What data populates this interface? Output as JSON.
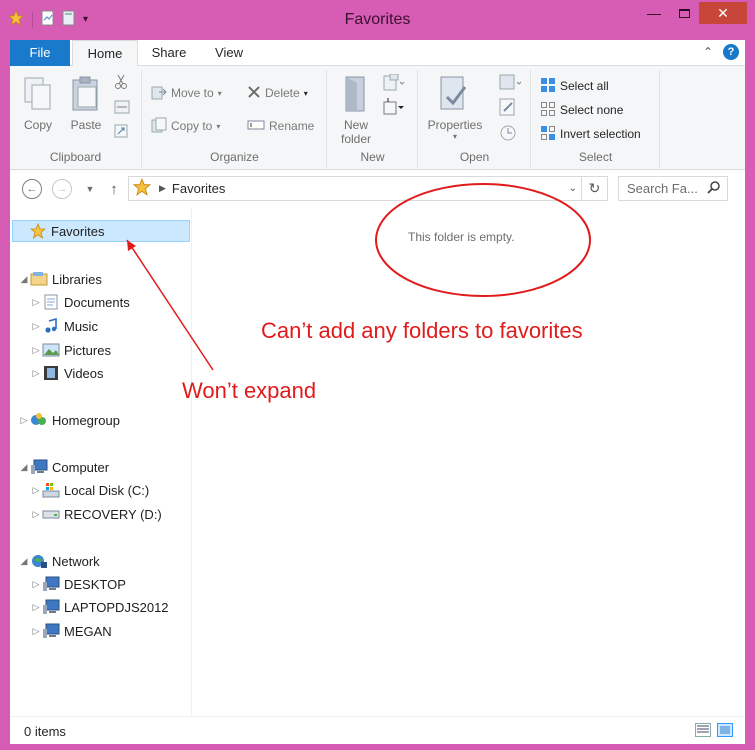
{
  "window": {
    "title": "Favorites"
  },
  "tabs": {
    "file": "File",
    "home": "Home",
    "share": "Share",
    "view": "View"
  },
  "ribbon": {
    "clipboard": {
      "label": "Clipboard",
      "copy": "Copy",
      "paste": "Paste"
    },
    "organize": {
      "label": "Organize",
      "move_to": "Move to",
      "copy_to": "Copy to",
      "delete": "Delete",
      "rename": "Rename"
    },
    "new": {
      "label": "New",
      "new_folder_line1": "New",
      "new_folder_line2": "folder"
    },
    "open": {
      "label": "Open",
      "properties": "Properties"
    },
    "select": {
      "label": "Select",
      "select_all": "Select all",
      "select_none": "Select none",
      "invert": "Invert selection"
    }
  },
  "address": {
    "crumb": "Favorites",
    "search_placeholder": "Search Fa..."
  },
  "nav": {
    "favorites": "Favorites",
    "libraries": "Libraries",
    "documents": "Documents",
    "music": "Music",
    "pictures": "Pictures",
    "videos": "Videos",
    "homegroup": "Homegroup",
    "computer": "Computer",
    "local_disk": "Local Disk (C:)",
    "recovery": "RECOVERY (D:)",
    "network": "Network",
    "desktop": "DESKTOP",
    "laptop": "LAPTOPDJS2012",
    "megan": "MEGAN"
  },
  "content": {
    "empty_message": "This folder is empty."
  },
  "annotations": {
    "cant_add": "Can’t add any folders to favorites",
    "wont_expand": "Won’t expand",
    "color": "#e11b1b"
  },
  "status": {
    "items": "0 items"
  },
  "colors": {
    "frame": "#d75cb4",
    "file_tab": "#1979ca",
    "close_button": "#c8453a",
    "selection": "#cce8ff"
  }
}
